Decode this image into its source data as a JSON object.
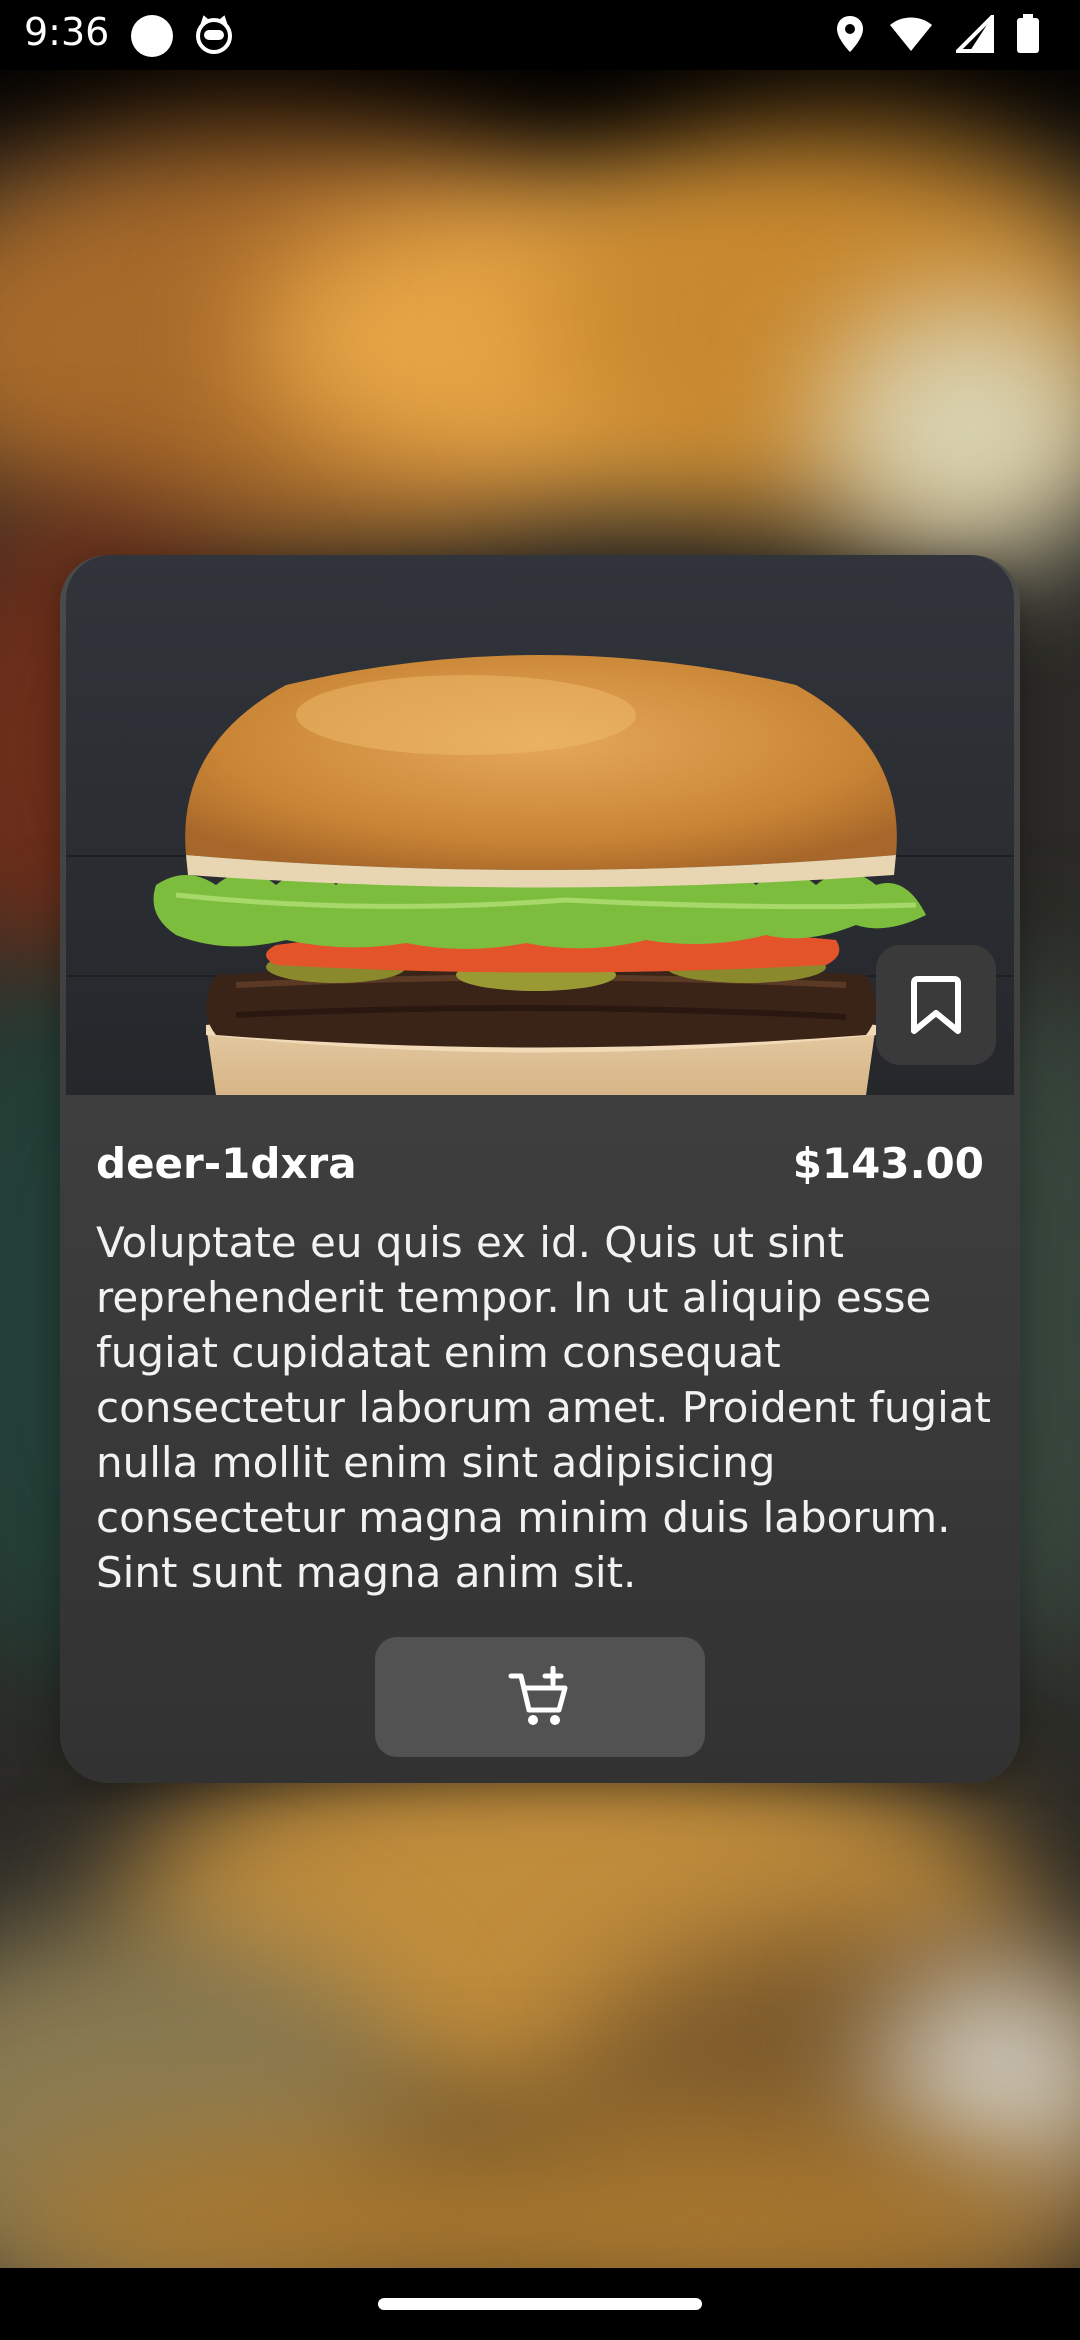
{
  "status_bar": {
    "time": "9:36",
    "left_icons": [
      "circle-notification-icon",
      "cat-app-icon"
    ],
    "right_icons": [
      "location-icon",
      "wifi-icon",
      "signal-icon",
      "battery-icon"
    ]
  },
  "product": {
    "name": "deer-1dxra",
    "price": "$143.00",
    "description": "Voluptate eu quis ex id. Quis ut sint reprehenderit tempor. In ut aliquip esse fugiat cupidatat enim consequat consectetur laborum amet. Proident fugiat nulla mollit enim sint adipisicing consectetur magna minim duis laborum. Sint sunt magna anim sit.",
    "image_subject": "burger",
    "bookmark_icon": "bookmark-icon",
    "cart_icon": "cart-plus-icon"
  },
  "colors": {
    "card_background": "#3e3e3e",
    "button_background": "#525252",
    "text": "#ffffff"
  }
}
